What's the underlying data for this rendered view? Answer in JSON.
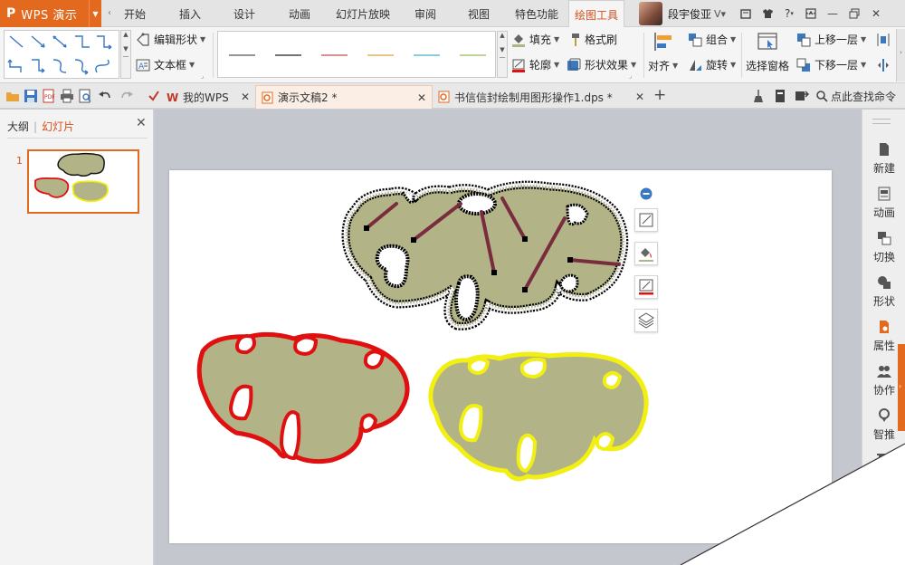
{
  "app": {
    "logo": "P",
    "name": "WPS 演示"
  },
  "ribbon_tabs": [
    {
      "label": "开始"
    },
    {
      "label": "插入"
    },
    {
      "label": "设计"
    },
    {
      "label": "动画"
    },
    {
      "label": "幻灯片放映"
    },
    {
      "label": "审阅"
    },
    {
      "label": "视图"
    },
    {
      "label": "特色功能"
    },
    {
      "label": "绘图工具",
      "active": true
    }
  ],
  "user": {
    "name": "段宇俊亚"
  },
  "window_controls": [
    "help",
    "minimize",
    "restore",
    "close"
  ],
  "ribbon": {
    "edit_shape": "编辑形状",
    "text_box": "文本框",
    "fill": "填充",
    "format_painter": "格式刷",
    "outline": "轮廓",
    "shape_effect": "形状效果",
    "align": "对齐",
    "group": "组合",
    "rotate": "旋转",
    "selection_pane": "选择窗格",
    "bring_forward": "上移一层",
    "send_backward": "下移一层",
    "line_colors": [
      "#555555",
      "#222222",
      "#c0504d",
      "#d9a441",
      "#4bacc6",
      "#9bbb59"
    ]
  },
  "doc_tabs": [
    {
      "label": "我的WPS"
    },
    {
      "label": "演示文稿2 *",
      "active": true
    },
    {
      "label": "书信信封绘制用图形操作1.dps *"
    }
  ],
  "search_command": "点此查找命令",
  "left_panel": {
    "tab_outline": "大纲",
    "tab_slides": "幻灯片",
    "slide_number": "1"
  },
  "right_bar": [
    {
      "label": "新建",
      "icon": "new-file-icon"
    },
    {
      "label": "动画",
      "icon": "animation-icon"
    },
    {
      "label": "切换",
      "icon": "transition-icon"
    },
    {
      "label": "形状",
      "icon": "shapes-icon"
    },
    {
      "label": "属性",
      "icon": "properties-icon"
    },
    {
      "label": "协作",
      "icon": "collaborate-icon"
    },
    {
      "label": "智推",
      "icon": "smart-push-icon"
    }
  ],
  "colors": {
    "accent": "#e3691f",
    "shape_fill": "#b3b388",
    "shape_red_outline": "#e01010",
    "shape_yellow_outline": "#f2ef12",
    "connector": "#7a2c3f"
  }
}
